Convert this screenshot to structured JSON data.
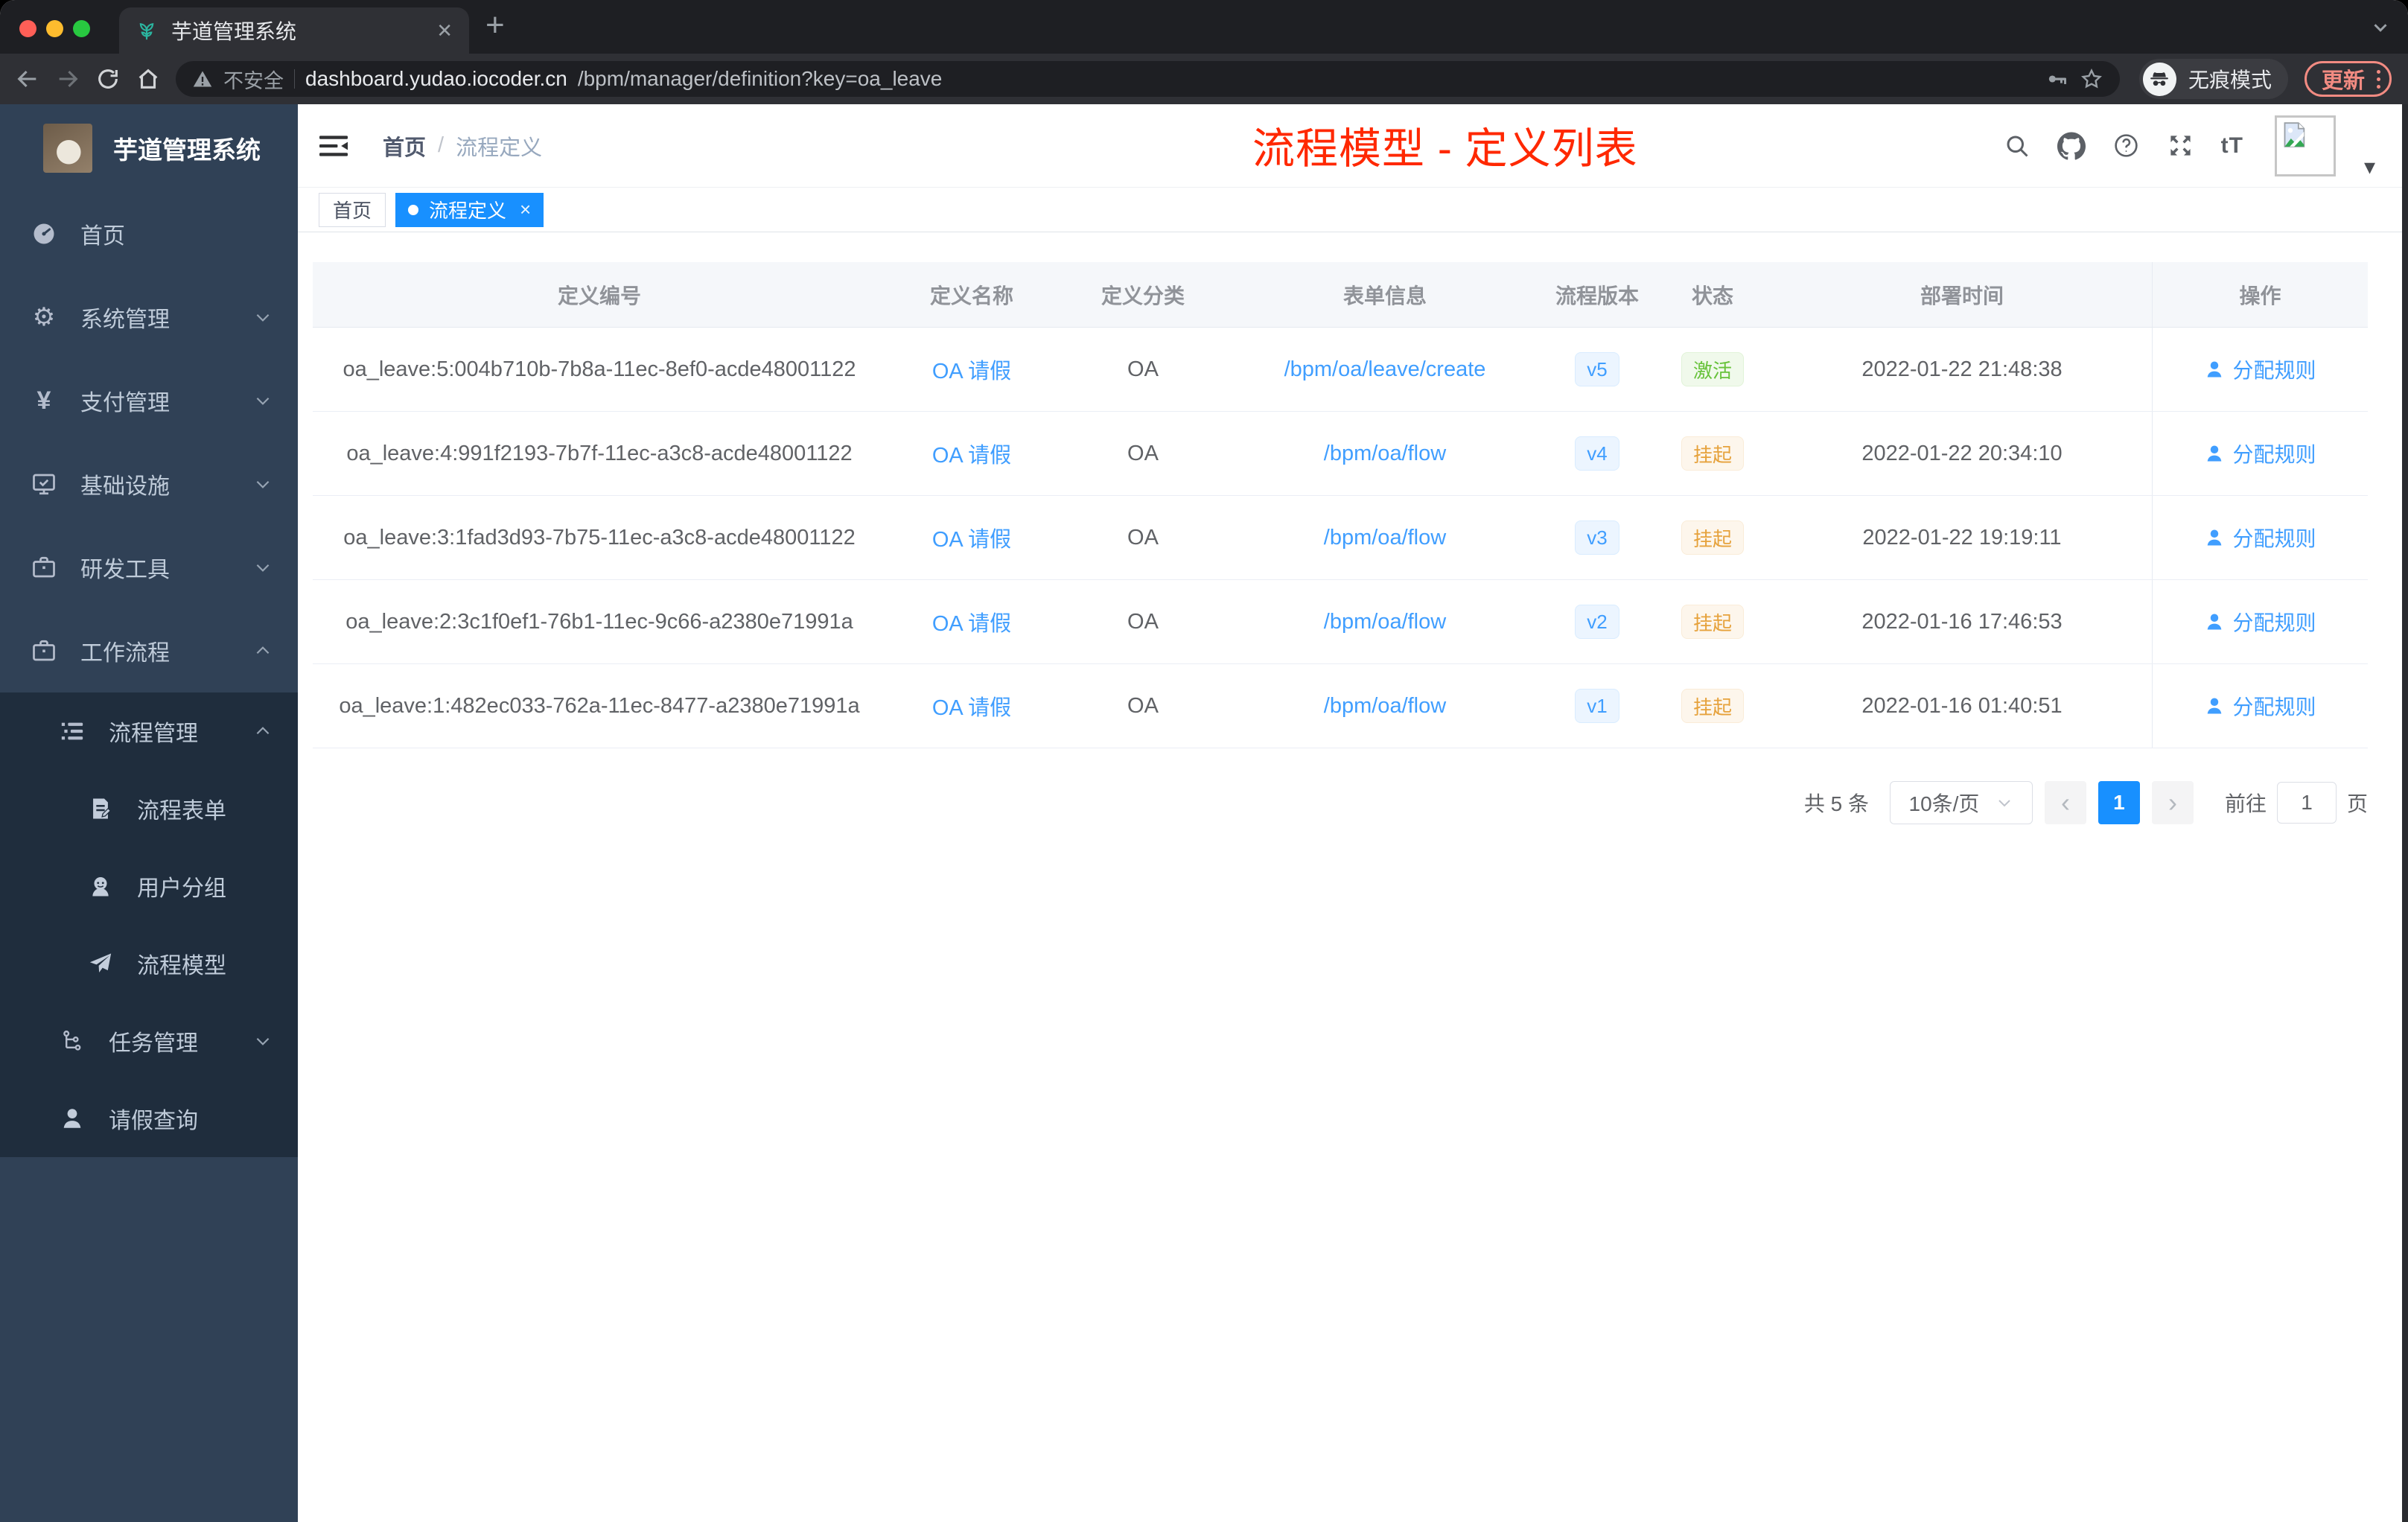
{
  "browser": {
    "tab_title": "芋道管理系统",
    "security_label": "不安全",
    "url_domain": "dashboard.yudao.iocoder.cn",
    "url_path": "/bpm/manager/definition?key=oa_leave",
    "incognito_label": "无痕模式",
    "update_label": "更新"
  },
  "glyphs": {
    "tab_close": "✕",
    "new_tab": "+",
    "caret": "▾",
    "yen": "¥",
    "gear": "⚙",
    "font_size": "tT",
    "prev": "‹",
    "next": "›",
    "tag_close": "×",
    "breadcrumb_sep": "/"
  },
  "sidebar": {
    "title": "芋道管理系统",
    "menu": [
      {
        "label": "首页",
        "icon": "dashboard-icon"
      },
      {
        "label": "系统管理",
        "icon": "gear-icon"
      },
      {
        "label": "支付管理",
        "icon": "yen-icon"
      },
      {
        "label": "基础设施",
        "icon": "monitor-icon"
      },
      {
        "label": "研发工具",
        "icon": "briefcase-icon"
      },
      {
        "label": "工作流程",
        "icon": "suitcase-icon"
      },
      {
        "label": "流程管理",
        "icon": "list-tree-icon"
      },
      {
        "label": "流程表单",
        "icon": "form-doc-icon"
      },
      {
        "label": "用户分组",
        "icon": "user-group-icon"
      },
      {
        "label": "流程模型",
        "icon": "paper-plane-icon"
      },
      {
        "label": "任务管理",
        "icon": "org-tree-icon"
      },
      {
        "label": "请假查询",
        "icon": "person-icon"
      }
    ]
  },
  "navbar": {
    "breadcrumb_home": "首页",
    "breadcrumb_current": "流程定义",
    "annotation": "流程模型 - 定义列表"
  },
  "tags": {
    "home": "首页",
    "active": "流程定义"
  },
  "table": {
    "columns": [
      "定义编号",
      "定义名称",
      "定义分类",
      "表单信息",
      "流程版本",
      "状态",
      "部署时间",
      "操作"
    ],
    "action_label": "分配规则",
    "rows": [
      {
        "id": "oa_leave:5:004b710b-7b8a-11ec-8ef0-acde48001122",
        "name": "OA 请假",
        "category": "OA",
        "form": "/bpm/oa/leave/create",
        "version": "v5",
        "status": "激活",
        "status_type": "success",
        "deploy_time": "2022-01-22 21:48:38"
      },
      {
        "id": "oa_leave:4:991f2193-7b7f-11ec-a3c8-acde48001122",
        "name": "OA 请假",
        "category": "OA",
        "form": "/bpm/oa/flow",
        "version": "v4",
        "status": "挂起",
        "status_type": "warning",
        "deploy_time": "2022-01-22 20:34:10"
      },
      {
        "id": "oa_leave:3:1fad3d93-7b75-11ec-a3c8-acde48001122",
        "name": "OA 请假",
        "category": "OA",
        "form": "/bpm/oa/flow",
        "version": "v3",
        "status": "挂起",
        "status_type": "warning",
        "deploy_time": "2022-01-22 19:19:11"
      },
      {
        "id": "oa_leave:2:3c1f0ef1-76b1-11ec-9c66-a2380e71991a",
        "name": "OA 请假",
        "category": "OA",
        "form": "/bpm/oa/flow",
        "version": "v2",
        "status": "挂起",
        "status_type": "warning",
        "deploy_time": "2022-01-16 17:46:53"
      },
      {
        "id": "oa_leave:1:482ec033-762a-11ec-8477-a2380e71991a",
        "name": "OA 请假",
        "category": "OA",
        "form": "/bpm/oa/flow",
        "version": "v1",
        "status": "挂起",
        "status_type": "warning",
        "deploy_time": "2022-01-16 01:40:51"
      }
    ]
  },
  "pagination": {
    "total": "共 5 条",
    "page_size": "10条/页",
    "current_page": "1",
    "goto_label": "前往",
    "goto_value": "1",
    "page_unit": "页"
  },
  "colors": {
    "accent_blue": "#1890ff",
    "link_blue": "#409eff",
    "success_green": "#67c23a",
    "warning_orange": "#e6a23c",
    "annotation_red": "#ff2800",
    "sidebar_bg": "#304156",
    "submenu_bg": "#1f2d3d"
  }
}
